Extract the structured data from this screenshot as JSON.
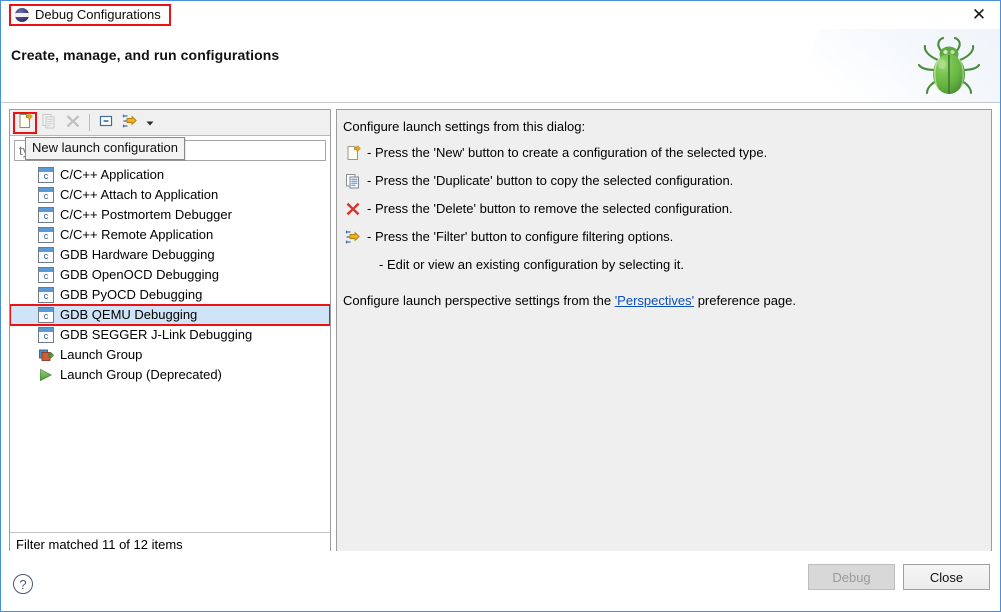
{
  "window": {
    "title": "Debug Configurations",
    "close_label": "✕",
    "app_icon": "eclipse-icon"
  },
  "banner": {
    "heading": "Create, manage, and run configurations",
    "decoration_icon": "bug-icon"
  },
  "toolbar": {
    "buttons": [
      {
        "name": "new-launch-configuration-button",
        "icon": "new-document-icon",
        "enabled": true,
        "highlighted": true
      },
      {
        "name": "duplicate-button",
        "icon": "duplicate-icon",
        "enabled": false,
        "highlighted": false
      },
      {
        "name": "delete-button",
        "icon": "delete-x-icon",
        "enabled": false,
        "highlighted": false
      },
      {
        "name": "collapse-all-button",
        "icon": "collapse-all-icon",
        "enabled": true,
        "highlighted": false
      },
      {
        "name": "filter-button",
        "icon": "filter-icon",
        "enabled": true,
        "highlighted": false
      }
    ],
    "dropdown_icon": "chevron-down-icon"
  },
  "tooltip": {
    "text": "New launch configuration"
  },
  "filter": {
    "value": "",
    "placeholder": "type filter text",
    "status": "Filter matched 11 of 12 items"
  },
  "tree": {
    "items": [
      {
        "label": "C/C++ Application",
        "icon": "cpp-config-icon",
        "selected": false,
        "boxed": false
      },
      {
        "label": "C/C++ Attach to Application",
        "icon": "cpp-config-icon",
        "selected": false,
        "boxed": false
      },
      {
        "label": "C/C++ Postmortem Debugger",
        "icon": "cpp-config-icon",
        "selected": false,
        "boxed": false
      },
      {
        "label": "C/C++ Remote Application",
        "icon": "cpp-config-icon",
        "selected": false,
        "boxed": false
      },
      {
        "label": "GDB Hardware Debugging",
        "icon": "cpp-config-icon",
        "selected": false,
        "boxed": false
      },
      {
        "label": "GDB OpenOCD Debugging",
        "icon": "cpp-config-icon",
        "selected": false,
        "boxed": false
      },
      {
        "label": "GDB PyOCD Debugging",
        "icon": "cpp-config-icon",
        "selected": false,
        "boxed": false
      },
      {
        "label": "GDB QEMU Debugging",
        "icon": "cpp-config-icon",
        "selected": true,
        "boxed": true
      },
      {
        "label": "GDB SEGGER J-Link Debugging",
        "icon": "cpp-config-icon",
        "selected": false,
        "boxed": false
      },
      {
        "label": "Launch Group",
        "icon": "launch-group-icon",
        "selected": false,
        "boxed": false
      },
      {
        "label": "Launch Group (Deprecated)",
        "icon": "launch-group-deprecated-icon",
        "selected": false,
        "boxed": false
      }
    ]
  },
  "details": {
    "intro": "Configure launch settings from this dialog:",
    "rows": [
      {
        "icon": "new-document-icon",
        "text": "- Press the 'New' button to create a configuration of the selected type."
      },
      {
        "icon": "duplicate-icon",
        "text": "- Press the 'Duplicate' button to copy the selected configuration."
      },
      {
        "icon": "delete-x-icon",
        "text": "- Press the 'Delete' button to remove the selected configuration."
      },
      {
        "icon": "filter-icon",
        "text": "- Press the 'Filter' button to configure filtering options."
      },
      {
        "icon": "none",
        "text": "- Edit or view an existing configuration by selecting it."
      }
    ],
    "footer_before": "Configure launch perspective settings from the ",
    "footer_link": "'Perspectives'",
    "footer_after": " preference page."
  },
  "footer": {
    "help_label": "?",
    "debug_label": "Debug",
    "close_label": "Close"
  },
  "colors": {
    "accent_highlight": "#ee1111",
    "selection": "#cfe4f7",
    "link": "#0c4fb8",
    "panel_bg": "#efefef"
  }
}
